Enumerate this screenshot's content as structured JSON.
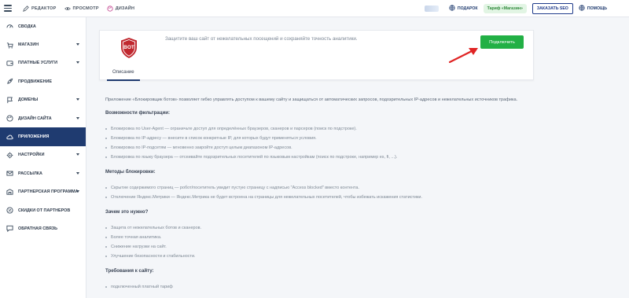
{
  "topbar": {
    "nav": [
      {
        "label": "Редактор",
        "icon": "pencil-icon"
      },
      {
        "label": "Просмотр",
        "icon": "eye-icon"
      },
      {
        "label": "Дизайн",
        "icon": "palette-icon"
      }
    ],
    "gift_label": "Подарок",
    "tariff_label": "Тариф «Магазин»",
    "seo_label": "Заказать SEO",
    "help_label": "Помощь"
  },
  "sidebar": {
    "items": [
      {
        "label": "Сводка",
        "icon": "dashboard-icon"
      },
      {
        "label": "Магазин",
        "icon": "cart-icon"
      },
      {
        "label": "Платные услуги",
        "icon": "wallet-icon"
      },
      {
        "label": "Продвижение",
        "icon": "rocket-icon"
      },
      {
        "label": "Домены",
        "icon": "flag-icon"
      },
      {
        "label": "Дизайн сайта",
        "icon": "palette-icon"
      },
      {
        "label": "Приложения",
        "icon": "cloud-icon"
      },
      {
        "label": "Настройки",
        "icon": "gear-icon"
      },
      {
        "label": "Рассылка",
        "icon": "envelope-icon"
      },
      {
        "label": "Партнерская программа",
        "icon": "partner-icon"
      },
      {
        "label": "Скидки от партнеров",
        "icon": "discount-icon"
      },
      {
        "label": "Обратная связь",
        "icon": "chat-icon"
      }
    ]
  },
  "app_card": {
    "badge_text": "BOT",
    "description": "Защитите ваш сайт от нежелательных посещений и сохраняйте точность аналитики.",
    "connect_label": "Подключить",
    "tab_label": "Описание"
  },
  "content": {
    "intro": "Приложение «Блокировщик ботов» позволяет гибко управлять доступом к вашему сайту и защищаться от автоматических запросов, подозрительных IP-адресов и нежелательных источников трафика.",
    "sections": [
      {
        "title": "Возможности фильтрации:",
        "items": [
          "Блокировка по User-Agent — ограничьте доступ для определённых браузеров, сканеров и парсеров (поиск по подстроке).",
          "Блокировка по IP-адресу — внесите в список конкретные IP, для которых будут применяться условия.",
          "Блокировка по IP-подсетям — мгновенно закройте доступ целым диапазоном IP-адресов.",
          "Блокировка по языку браузера — отсеивайте подозрительных посетителей по языковым настройкам (поиск по подстроке, например es, fi, ...)."
        ]
      },
      {
        "title": "Методы блокировки:",
        "items": [
          "Скрытие содержимого страниц — робот/посетитель увидит пустую страницу с надписью \"Access blocked\" вместо контента.",
          "Отключение Яндекс.Метрики — Яндекс.Метрика не будет встроена на страницы для нежелательных посетителей, чтобы избежать искажения статистики."
        ]
      },
      {
        "title": "Зачем это нужно?",
        "items": [
          "Защита от нежелательных ботов и сканеров.",
          "Более точная аналитика.",
          "Снижение нагрузки на сайт.",
          "Улучшение безопасности и стабильности."
        ]
      },
      {
        "title": "Требования к сайту:",
        "items": [
          "подключенный платный тариф"
        ]
      }
    ]
  },
  "colors": {
    "primary": "#1f3b70",
    "connect_green": "#22b045",
    "badge_red": "#c0282f",
    "arrow_red": "#e02424",
    "tariff_bg": "#e2f5e4"
  }
}
